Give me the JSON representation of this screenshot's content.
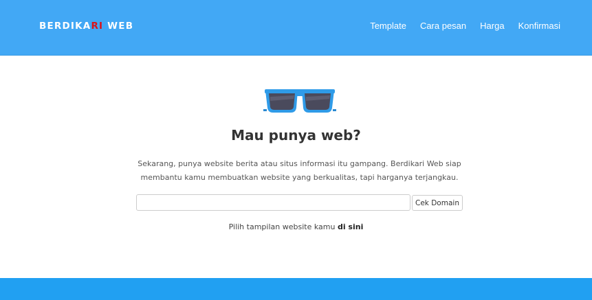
{
  "brand": {
    "prefix": "BERDIKA",
    "accent": "RI",
    "suffix": " WEB"
  },
  "nav": {
    "items": [
      {
        "label": "Template"
      },
      {
        "label": "Cara pesan"
      },
      {
        "label": "Harga"
      },
      {
        "label": "Konfirmasi"
      }
    ]
  },
  "hero": {
    "icon": "sunglasses-icon",
    "title": "Mau punya web?",
    "description": "Sekarang, punya website berita atau situs informasi itu gampang. Berdikari Web siap membantu kamu membuatkan website yang berkualitas, tapi harganya terjangkau."
  },
  "domain_form": {
    "value": "",
    "placeholder": "",
    "button_label": "Cek Domain"
  },
  "choose": {
    "text": "Pilih tampilan website kamu ",
    "link_label": "di sini"
  },
  "colors": {
    "navbar": "#42a8f5",
    "brand_accent": "#d9121a",
    "footer_band": "#21a0f2",
    "sunglasses_frame": "#2f9be8",
    "sunglasses_lens": "#4a4a5c"
  }
}
